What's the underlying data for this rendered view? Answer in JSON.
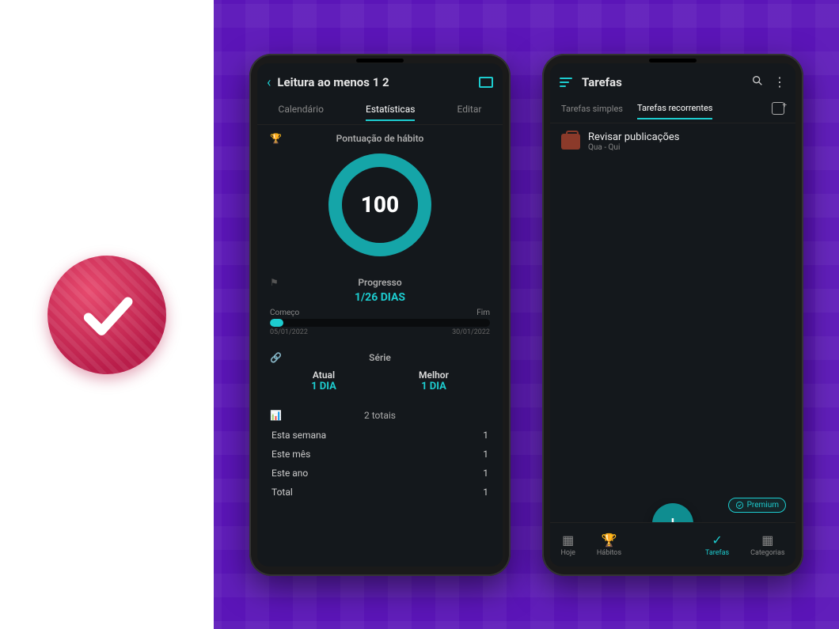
{
  "phone1": {
    "header_title": "Leitura ao menos 1 2",
    "tabs": {
      "calendar": "Calendário",
      "stats": "Estatísticas",
      "edit": "Editar"
    },
    "score": {
      "title": "Pontuação de hábito",
      "value": "100"
    },
    "progress": {
      "title": "Progresso",
      "value": "1/26 DIAS",
      "start_label": "Começo",
      "end_label": "Fim",
      "start_date": "05/01/2022",
      "end_date": "30/01/2022"
    },
    "streak": {
      "title": "Série",
      "current_label": "Atual",
      "current_value": "1 DIA",
      "best_label": "Melhor",
      "best_value": "1 DIA"
    },
    "totals": {
      "title": "2 totais",
      "rows": [
        {
          "label": "Esta semana",
          "value": "1"
        },
        {
          "label": "Este mês",
          "value": "1"
        },
        {
          "label": "Este ano",
          "value": "1"
        },
        {
          "label": "Total",
          "value": "1"
        }
      ]
    }
  },
  "phone2": {
    "header_title": "Tarefas",
    "subtabs": {
      "simple": "Tarefas simples",
      "recurring": "Tarefas recorrentes"
    },
    "task": {
      "title": "Revisar publicações",
      "subtitle": "Qua - Qui"
    },
    "premium": "Premium",
    "nav": {
      "today": "Hoje",
      "habits": "Hábitos",
      "tasks": "Tarefas",
      "categories": "Categorias"
    }
  },
  "chart_data": {
    "type": "table",
    "title": "Estatísticas — Leitura ao menos 1 2",
    "score": 100,
    "progress": {
      "days_done": 1,
      "days_total": 26,
      "start": "05/01/2022",
      "end": "30/01/2022"
    },
    "streak": {
      "current_days": 1,
      "best_days": 1
    },
    "totals": {
      "this_week": 1,
      "this_month": 1,
      "this_year": 1,
      "total": 1
    }
  }
}
